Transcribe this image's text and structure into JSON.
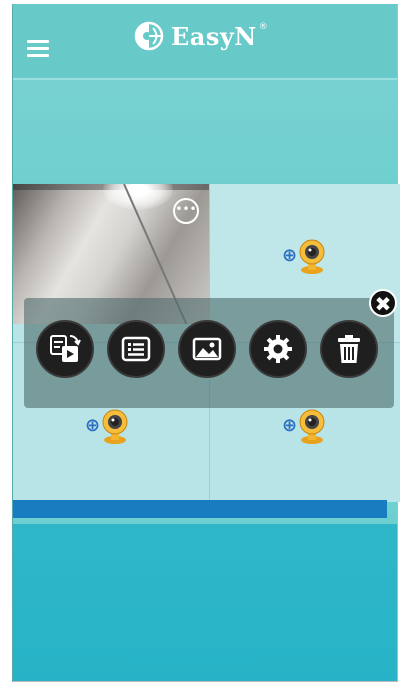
{
  "header": {
    "brand_name": "EasyN",
    "registered_mark": "®",
    "menu_icon": "hamburger-menu-icon",
    "logo_icon": "globe-logo-icon"
  },
  "camera_grid": {
    "cells": [
      {
        "state": "live-feed",
        "more_label": "•••"
      },
      {
        "state": "empty",
        "add_symbol": "⊕"
      },
      {
        "state": "empty",
        "add_symbol": "⊕"
      },
      {
        "state": "empty",
        "add_symbol": "⊕"
      }
    ]
  },
  "toolbar": {
    "buttons": [
      {
        "icon": "playback-switch-icon"
      },
      {
        "icon": "device-info-list-icon"
      },
      {
        "icon": "image-gallery-icon"
      },
      {
        "icon": "settings-gear-icon"
      },
      {
        "icon": "delete-trash-icon"
      }
    ],
    "close_symbol": "✖"
  },
  "colors": {
    "header": "#67c9c8",
    "accent_blue": "#1a7cc0",
    "bottom_area": "#27b3c7",
    "button_dark": "#1f1f1f"
  }
}
